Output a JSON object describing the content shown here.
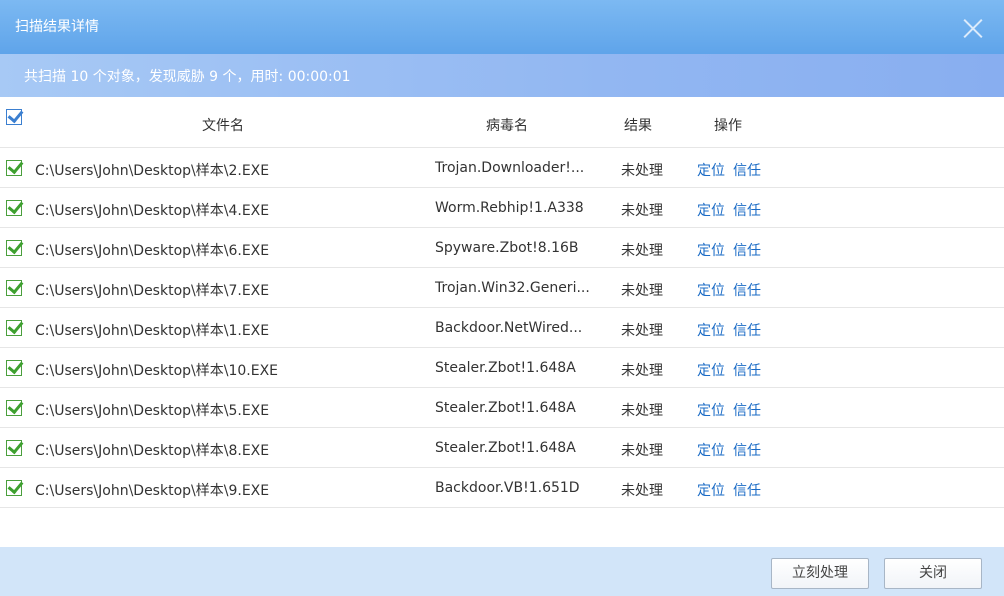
{
  "window": {
    "title": "扫描结果详情"
  },
  "summary": {
    "text": "共扫描 10 个对象，发现威胁 9 个，用时: 00:00:01"
  },
  "table": {
    "headers": {
      "file": "文件名",
      "virus": "病毒名",
      "result": "结果",
      "action": "操作"
    },
    "rows": [
      {
        "file": "C:\\Users\\John\\Desktop\\样本\\2.EXE",
        "virus": "Trojan.Downloader!...",
        "result": "未处理",
        "locate": "定位",
        "trust": "信任"
      },
      {
        "file": "C:\\Users\\John\\Desktop\\样本\\4.EXE",
        "virus": "Worm.Rebhip!1.A338",
        "result": "未处理",
        "locate": "定位",
        "trust": "信任"
      },
      {
        "file": "C:\\Users\\John\\Desktop\\样本\\6.EXE",
        "virus": "Spyware.Zbot!8.16B",
        "result": "未处理",
        "locate": "定位",
        "trust": "信任"
      },
      {
        "file": "C:\\Users\\John\\Desktop\\样本\\7.EXE",
        "virus": "Trojan.Win32.Generi...",
        "result": "未处理",
        "locate": "定位",
        "trust": "信任"
      },
      {
        "file": "C:\\Users\\John\\Desktop\\样本\\1.EXE",
        "virus": "Backdoor.NetWired...",
        "result": "未处理",
        "locate": "定位",
        "trust": "信任"
      },
      {
        "file": "C:\\Users\\John\\Desktop\\样本\\10.EXE",
        "virus": "Stealer.Zbot!1.648A",
        "result": "未处理",
        "locate": "定位",
        "trust": "信任"
      },
      {
        "file": "C:\\Users\\John\\Desktop\\样本\\5.EXE",
        "virus": "Stealer.Zbot!1.648A",
        "result": "未处理",
        "locate": "定位",
        "trust": "信任"
      },
      {
        "file": "C:\\Users\\John\\Desktop\\样本\\8.EXE",
        "virus": "Stealer.Zbot!1.648A",
        "result": "未处理",
        "locate": "定位",
        "trust": "信任"
      },
      {
        "file": "C:\\Users\\John\\Desktop\\样本\\9.EXE",
        "virus": "Backdoor.VB!1.651D",
        "result": "未处理",
        "locate": "定位",
        "trust": "信任"
      }
    ]
  },
  "footer": {
    "process_label": "立刻处理",
    "close_label": "关闭"
  },
  "colors": {
    "title_bar": "#6aaced",
    "summary_bar": "#96b9f2",
    "link": "#1a6bc6",
    "check_green": "#3ea02f",
    "footer_bg": "#d2e5f9"
  },
  "icons": {
    "close": "close-icon",
    "checkbox": "checkbox-checked-icon"
  }
}
